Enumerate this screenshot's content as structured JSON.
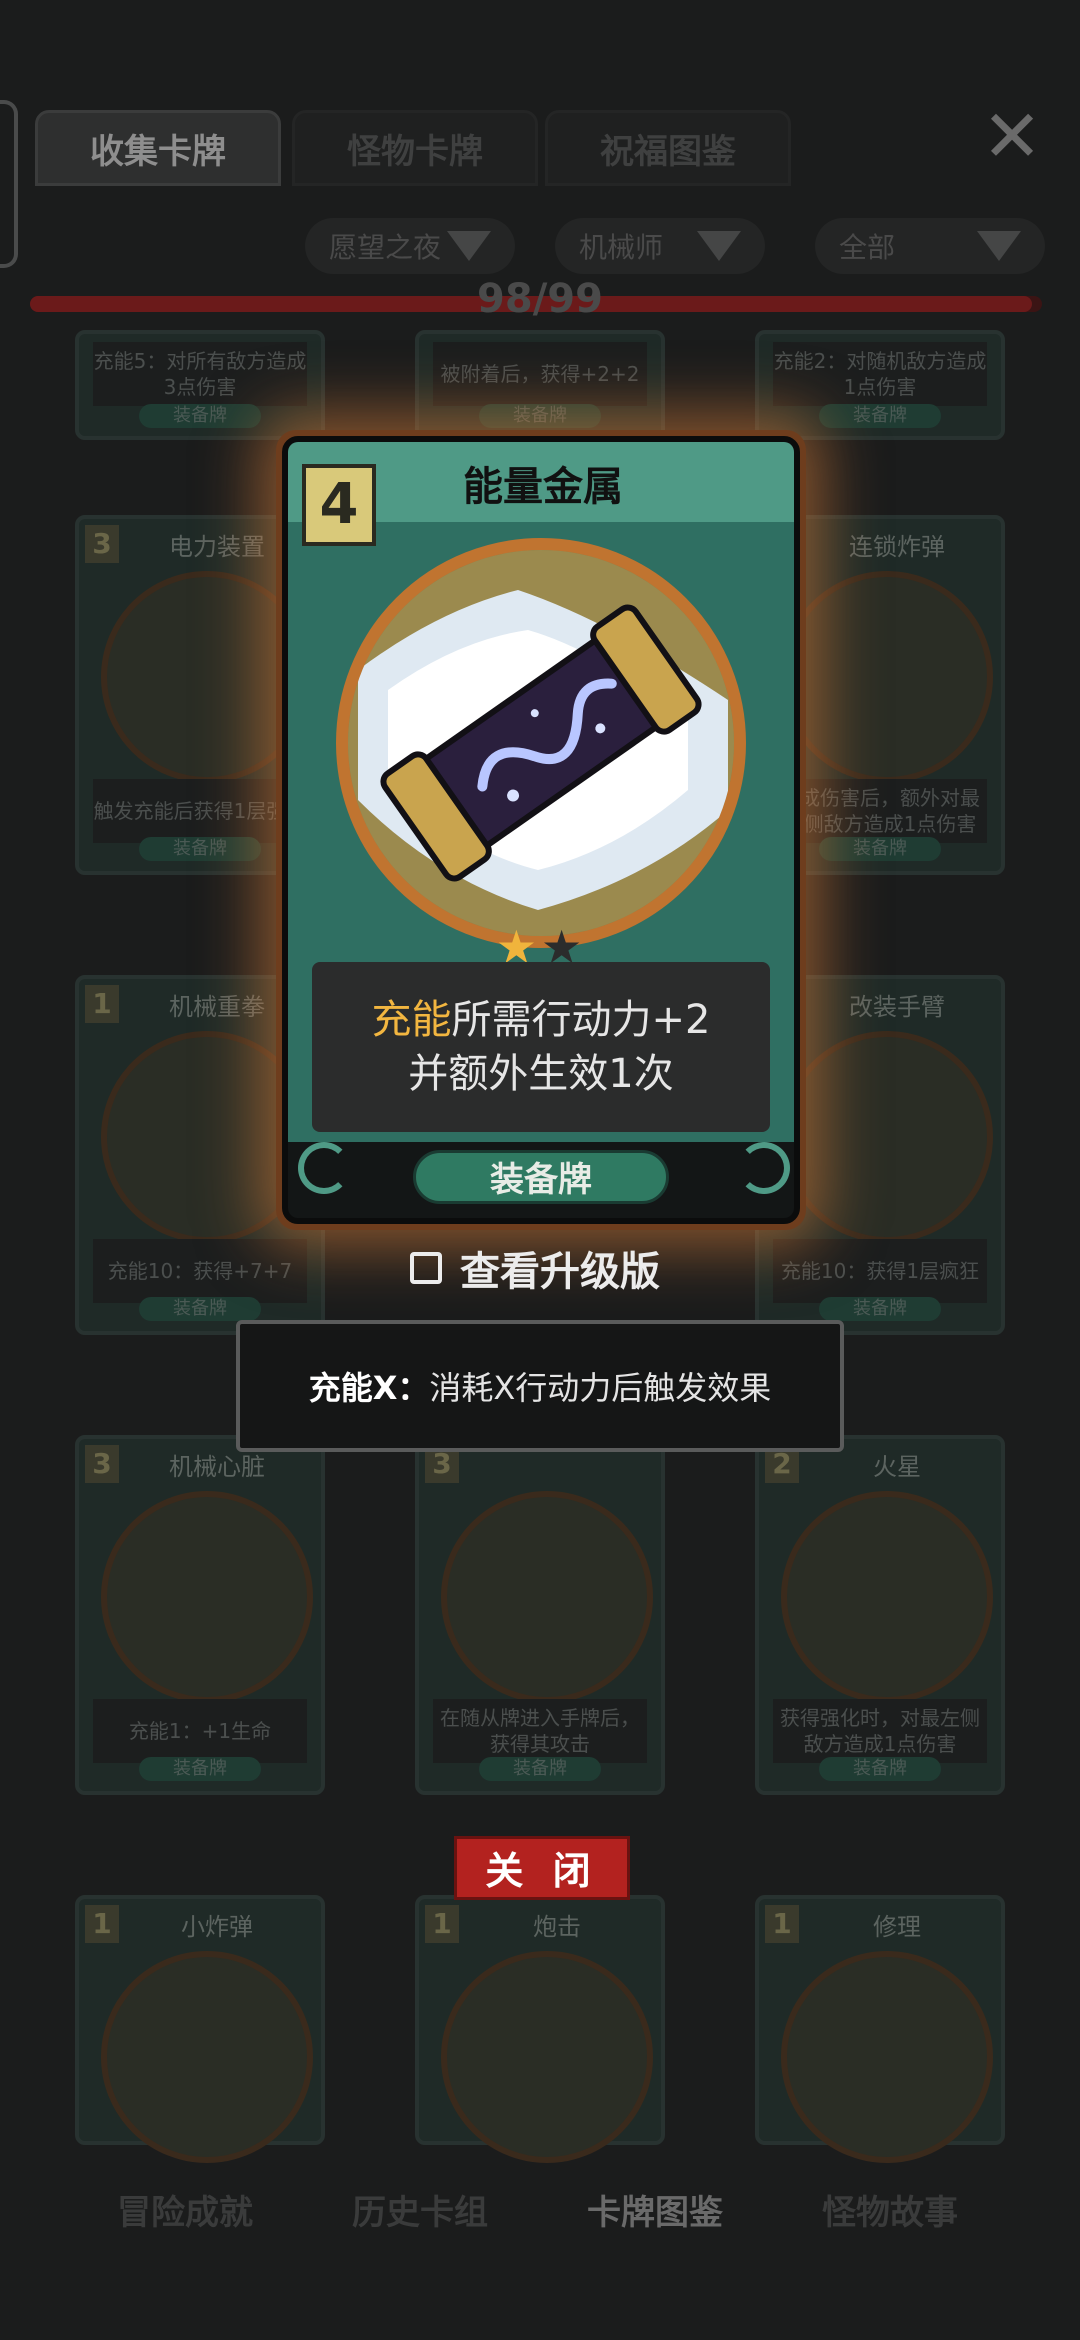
{
  "tabs": [
    {
      "label": "收集卡牌",
      "active": true
    },
    {
      "label": "怪物卡牌",
      "active": false
    },
    {
      "label": "祝福图鉴",
      "active": false
    }
  ],
  "filters": [
    "愿望之夜",
    "机械师",
    "全部"
  ],
  "progress": {
    "text": "98/99",
    "fraction": 0.9899
  },
  "bg_cards": {
    "row0": [
      {
        "desc": "充能5：对所有敌方造成3点伤害",
        "type": "装备牌"
      },
      {
        "desc": "被附着后，获得+2+2",
        "type": "装备牌"
      },
      {
        "desc": "充能2：对随机敌方造成1点伤害",
        "type": "装备牌"
      }
    ],
    "row1": [
      {
        "cost": "3",
        "name": "电力装置",
        "desc": "触发充能后获得1层强化",
        "type": "装备牌"
      },
      {
        "cost": "",
        "name": "",
        "desc": "",
        "type": ""
      },
      {
        "cost": "",
        "name": "连锁炸弹",
        "desc": "造成伤害后，额外对最左侧敌方造成1点伤害",
        "type": "装备牌"
      }
    ],
    "row2": [
      {
        "cost": "1",
        "name": "机械重拳",
        "desc": "充能10：获得+7+7",
        "type": "装备牌"
      },
      {
        "cost": "",
        "name": "",
        "desc": "",
        "type": ""
      },
      {
        "cost": "",
        "name": "改装手臂",
        "desc": "充能10：获得1层疯狂",
        "type": "装备牌"
      }
    ],
    "row3": [
      {
        "cost": "3",
        "name": "机械心脏",
        "desc": "充能1：+1生命",
        "type": "装备牌"
      },
      {
        "cost": "3",
        "name": "",
        "desc": "在随从牌进入手牌后，获得其攻击",
        "type": "装备牌"
      },
      {
        "cost": "2",
        "name": "火星",
        "desc": "获得强化时，对最左侧敌方造成1点伤害",
        "type": "装备牌"
      }
    ],
    "row4": [
      {
        "cost": "1",
        "name": "小炸弹",
        "desc": "",
        "type": ""
      },
      {
        "cost": "1",
        "name": "炮击",
        "desc": "",
        "type": ""
      },
      {
        "cost": "1",
        "name": "修理",
        "desc": "",
        "type": ""
      }
    ]
  },
  "main_card": {
    "cost": "4",
    "name": "能量金属",
    "stars": {
      "filled": 1,
      "total": 2
    },
    "desc_keyword": "充能",
    "desc_line1_rest": "所需行动力+2",
    "desc_line2": "并额外生效1次",
    "type": "装备牌",
    "colors": {
      "frame": "#2f6f62",
      "header": "#4f9a86",
      "glow": "#dc823c",
      "keyword": "#f2b640"
    }
  },
  "upgrade_label": "查看升级版",
  "tooltip": {
    "term": "充能X：",
    "text": "消耗X行动力后触发效果"
  },
  "close_button": "关 闭",
  "bottom_nav": [
    {
      "label": "冒险成就",
      "active": false
    },
    {
      "label": "历史卡组",
      "active": false
    },
    {
      "label": "卡牌图鉴",
      "active": true
    },
    {
      "label": "怪物故事",
      "active": false
    }
  ]
}
